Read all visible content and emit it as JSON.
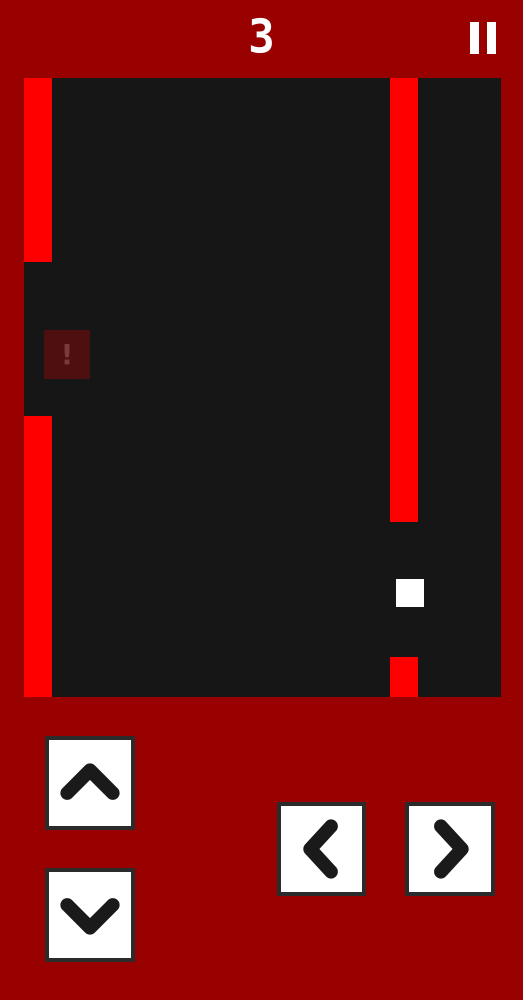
{
  "hud": {
    "score": "3",
    "pause_icon": "pause-icon"
  },
  "arena": {
    "warning_symbol": "!"
  },
  "controls": {
    "up_icon": "chevron-up-icon",
    "down_icon": "chevron-down-icon",
    "left_icon": "chevron-left-icon",
    "right_icon": "chevron-right-icon"
  },
  "colors": {
    "background": "#990000",
    "arena": "#161616",
    "wall": "#ff0000",
    "player": "#ffffff",
    "button_border": "#2b2b2b"
  }
}
